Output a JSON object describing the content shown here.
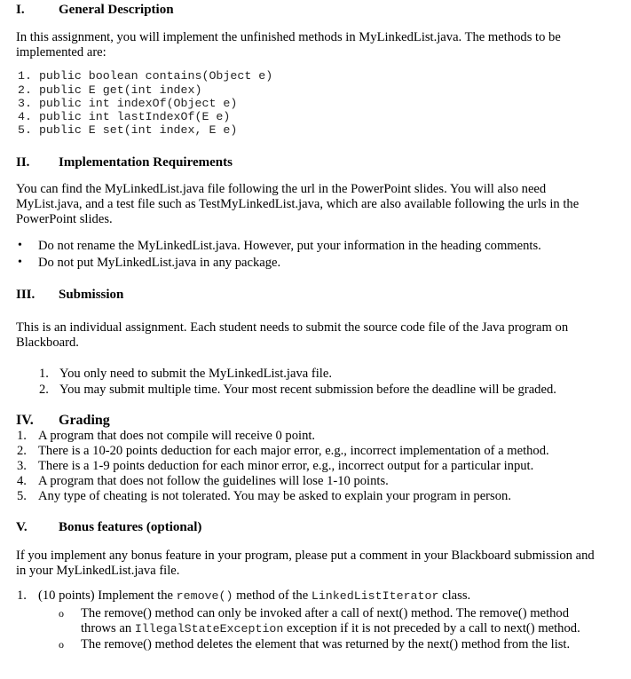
{
  "sections": [
    {
      "numeral": "I.",
      "title": "General Description",
      "intro_lines": [
        "In this assignment, you will implement the unfinished methods in MyLinkedList.java. The methods to be",
        "implemented are:"
      ],
      "methods": [
        "1. public boolean contains(Object e)",
        "2. public E get(int index)",
        "3. public int indexOf(Object e)",
        "4. public int lastIndexOf(E e)",
        "5. public E set(int index, E e)"
      ]
    },
    {
      "numeral": "II.",
      "title": "Implementation Requirements",
      "intro_lines": [
        "You can find the MyLinkedList.java file following the url in the PowerPoint slides. You will also need",
        "MyList.java, and a test file such as TestMyLinkedList.java, which are also available following the urls in the",
        "PowerPoint slides."
      ],
      "bullets": [
        "Do not rename the MyLinkedList.java. However, put your information in the heading comments.",
        "Do not put MyLinkedList.java in any package."
      ]
    },
    {
      "numeral": "III.",
      "title": "Submission",
      "intro_lines": [
        "This is an individual assignment. Each student needs to submit the source code file of the Java program on",
        "Blackboard."
      ],
      "items": [
        {
          "num": "1.",
          "text": "You only need to submit the MyLinkedList.java file."
        },
        {
          "num": "2.",
          "text": "You may submit multiple time. Your most recent submission before the deadline will be graded."
        }
      ]
    },
    {
      "numeral": "IV.",
      "title": "Grading",
      "items": [
        {
          "num": "1.",
          "text": "A program that does not compile will receive 0 point."
        },
        {
          "num": "2.",
          "text": "There is a 10-20 points deduction for each major error, e.g., incorrect implementation of a method."
        },
        {
          "num": "3.",
          "text": "There is a 1-9 points deduction for each minor error, e.g., incorrect output for a particular input."
        },
        {
          "num": "4.",
          "text": "A program that does not follow the guidelines will lose 1-10 points."
        },
        {
          "num": "5.",
          "text": "Any type of cheating is not tolerated. You may be asked to explain your program in person."
        }
      ]
    },
    {
      "numeral": "V.",
      "title": "Bonus features (optional)",
      "intro_lines": [
        "If you implement any bonus feature in your program, please put a comment in your Blackboard submission and",
        "in your MyLinkedList.java file."
      ],
      "bonus_item": {
        "num": "1.",
        "prefix": "(10 points) Implement the ",
        "code1": "remove()",
        "middle": " method of the ",
        "code2": "LinkedListIterator",
        "suffix": " class.",
        "sub_bullets": [
          {
            "line1": "The remove() method can only be invoked after a call of next() method. The remove() method",
            "line2_prefix": "throws an ",
            "line2_code": "IllegalStateException",
            "line2_suffix": " exception if it is not preceded by a call to next() method."
          },
          {
            "line1": "The remove() method deletes the element that was returned by the next() method from the list."
          }
        ],
        "sub_bullet_symbol": "o"
      }
    }
  ],
  "bullet_symbol": "•"
}
